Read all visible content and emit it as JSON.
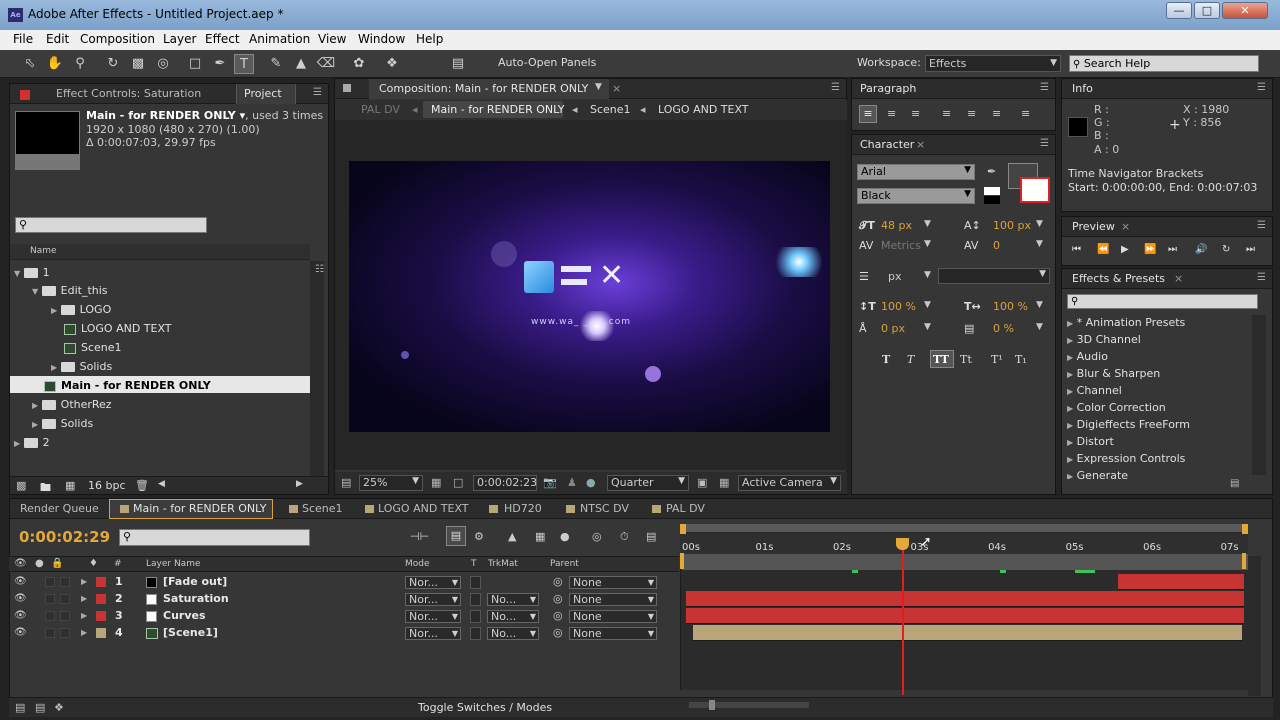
{
  "window": {
    "title": "Adobe After Effects - Untitled Project.aep *",
    "app_icon": "Ae"
  },
  "menu": [
    "File",
    "Edit",
    "Composition",
    "Layer",
    "Effect",
    "Animation",
    "View",
    "Window",
    "Help"
  ],
  "toolbar": {
    "auto_open_label": "Auto-Open Panels",
    "workspace_label": "Workspace:",
    "workspace_value": "Effects",
    "search_placeholder": "Search Help"
  },
  "project": {
    "tab_effect": "Effect Controls: Saturation",
    "tab_project": "Project",
    "item_name": "Main - for RENDER ONLY ▾",
    "used": ", used 3 times",
    "dims": "1920 x 1080  (480 x 270) (1.00)",
    "duration": "Δ 0:00:07:03, 29.97 fps",
    "col_name": "Name",
    "bpc": "16 bpc",
    "tree": [
      {
        "label": "1"
      },
      {
        "label": "Edit_this"
      },
      {
        "label": "LOGO"
      },
      {
        "label": "LOGO AND TEXT"
      },
      {
        "label": "Scene1"
      },
      {
        "label": "Solids"
      },
      {
        "label": "Main - for RENDER ONLY"
      },
      {
        "label": "OtherRez"
      },
      {
        "label": "Solids"
      },
      {
        "label": "2"
      }
    ]
  },
  "composition": {
    "tab": "Composition: Main - for RENDER ONLY",
    "breadcrumbs": [
      "PAL DV",
      "Main - for RENDER ONLY",
      "Scene1",
      "LOGO AND TEXT"
    ],
    "logo_url": "www.wa_ _ _1.com",
    "zoom": "25%",
    "time": "0:00:02:23",
    "resolution": "Quarter",
    "camera": "Active Camera"
  },
  "paragraph": {
    "tab": "Paragraph"
  },
  "character": {
    "tab": "Character",
    "font": "Arial",
    "style": "Black",
    "size": "48 px",
    "leading": "100 px",
    "kerning": "Metrics",
    "tracking": "0",
    "stroke": "px",
    "vscale": "100 %",
    "hscale": "100 %",
    "baseline": "0 px",
    "tsume": "0 %",
    "styles": [
      "T",
      "T",
      "TT",
      "Tt",
      "T¹",
      "T₁"
    ]
  },
  "info": {
    "tab": "Info",
    "r": "R :",
    "g": "G :",
    "b": "B :",
    "a": "A : 0",
    "x": "X : 1980",
    "y": "Y : 856",
    "msg1": "Time Navigator Brackets",
    "msg2": "Start: 0:00:00:00, End: 0:00:07:03"
  },
  "preview": {
    "tab": "Preview"
  },
  "effects": {
    "tab": "Effects & Presets",
    "items": [
      "* Animation Presets",
      "3D Channel",
      "Audio",
      "Blur & Sharpen",
      "Channel",
      "Color Correction",
      "Digieffects FreeForm",
      "Distort",
      "Expression Controls",
      "Generate"
    ]
  },
  "timeline": {
    "tabs": [
      "Render Queue",
      "Main - for RENDER ONLY",
      "Scene1",
      "LOGO AND TEXT",
      "HD720",
      "NTSC DV",
      "PAL DV"
    ],
    "timecode": "0:00:02:29",
    "col_layer": "Layer Name",
    "col_mode": "Mode",
    "col_t": "T",
    "col_trkmat": "TrkMat",
    "col_parent": "Parent",
    "col_num": "#",
    "ruler": [
      "00s",
      "01s",
      "02s",
      "03s",
      "04s",
      "05s",
      "06s",
      "07s"
    ],
    "layers": [
      {
        "num": "1",
        "name": "[Fade out]",
        "mode": "Nor...",
        "trkmat": "",
        "parent": "None",
        "color": "#c83434",
        "sw": "#000000"
      },
      {
        "num": "2",
        "name": "Saturation",
        "mode": "Nor...",
        "trkmat": "No...",
        "parent": "None",
        "color": "#c83434",
        "sw": "#ffffff"
      },
      {
        "num": "3",
        "name": "Curves",
        "mode": "Nor...",
        "trkmat": "No...",
        "parent": "None",
        "color": "#c83434",
        "sw": "#ffffff"
      },
      {
        "num": "4",
        "name": "[Scene1]",
        "mode": "Nor...",
        "trkmat": "No...",
        "parent": "None",
        "color": "#b9a57a",
        "sw": "comp"
      }
    ],
    "toggle": "Toggle Switches / Modes"
  },
  "colors": {
    "accent": "#e3a83a",
    "layer_bar": "#c83434",
    "comp_bar": "#b9a57a",
    "playhead": "#e02020"
  }
}
